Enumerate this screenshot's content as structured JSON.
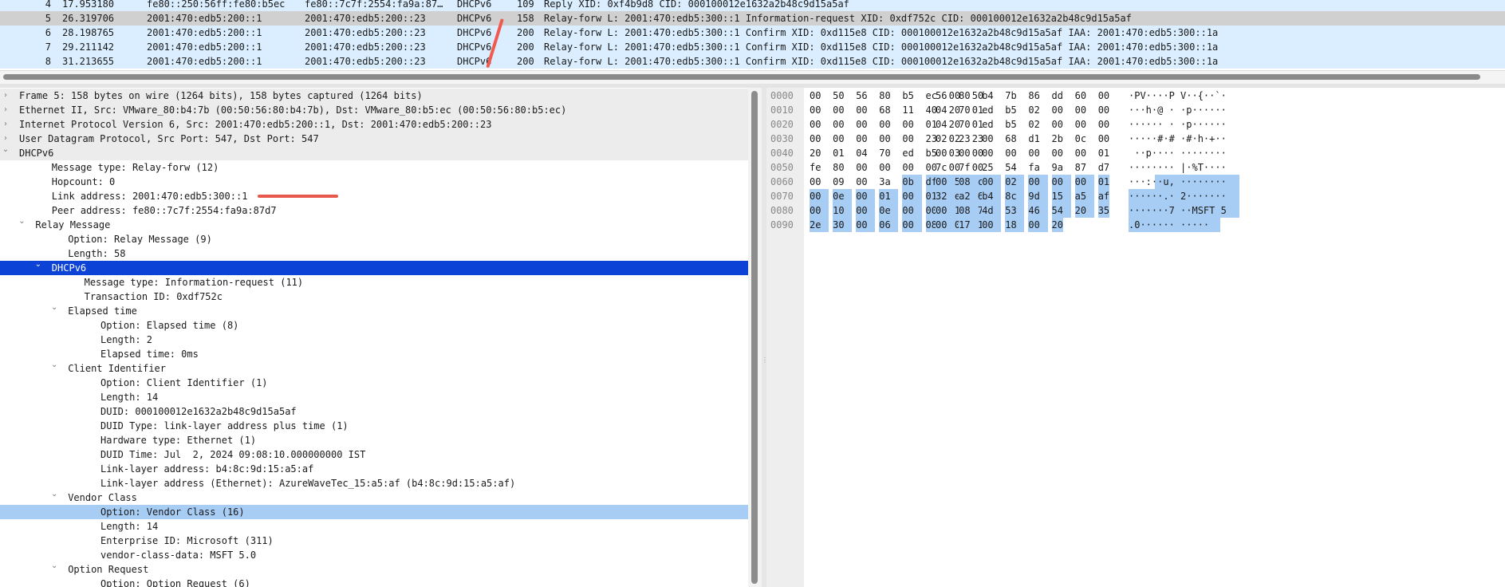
{
  "packet_list": {
    "rows": [
      {
        "no": "4",
        "time": "17.953180",
        "src": "fe80::250:56ff:fe80:b5ec",
        "dst": "fe80::7c7f:2554:fa9a:87…",
        "proto": "DHCPv6",
        "len": "109",
        "info": "Reply XID: 0xf4b9d8 CID: 000100012e1632a2b48c9d15a5af",
        "style": "udp"
      },
      {
        "no": "5",
        "time": "26.319706",
        "src": "2001:470:edb5:200::1",
        "dst": "2001:470:edb5:200::23",
        "proto": "DHCPv6",
        "len": "158",
        "info": "Relay-forw L: 2001:470:edb5:300::1 Information-request XID: 0xdf752c CID: 000100012e1632a2b48c9d15a5af",
        "style": "selected"
      },
      {
        "no": "6",
        "time": "28.198765",
        "src": "2001:470:edb5:200::1",
        "dst": "2001:470:edb5:200::23",
        "proto": "DHCPv6",
        "len": "200",
        "info": "Relay-forw L: 2001:470:edb5:300::1 Confirm XID: 0xd115e8 CID: 000100012e1632a2b48c9d15a5af IAA: 2001:470:edb5:300::1a",
        "style": "udp"
      },
      {
        "no": "7",
        "time": "29.211142",
        "src": "2001:470:edb5:200::1",
        "dst": "2001:470:edb5:200::23",
        "proto": "DHCPv6",
        "len": "200",
        "info": "Relay-forw L: 2001:470:edb5:300::1 Confirm XID: 0xd115e8 CID: 000100012e1632a2b48c9d15a5af IAA: 2001:470:edb5:300::1a",
        "style": "udp"
      },
      {
        "no": "8",
        "time": "31.213655",
        "src": "2001:470:edb5:200::1",
        "dst": "2001:470:edb5:200::23",
        "proto": "DHCPv6",
        "len": "200",
        "info": "Relay-forw L: 2001:470:edb5:300::1 Confirm XID: 0xd115e8 CID: 000100012e1632a2b48c9d15a5af IAA: 2001:470:edb5:300::1a",
        "style": "udp"
      }
    ]
  },
  "details": {
    "rows": [
      {
        "depth": 0,
        "expander": "collapsed",
        "text": "Frame 5: 158 bytes on wire (1264 bits), 158 bytes captured (1264 bits)",
        "style": "hdr"
      },
      {
        "depth": 0,
        "expander": "collapsed",
        "text": "Ethernet II, Src: VMware_80:b4:7b (00:50:56:80:b4:7b), Dst: VMware_80:b5:ec (00:50:56:80:b5:ec)",
        "style": "hdr"
      },
      {
        "depth": 0,
        "expander": "collapsed",
        "text": "Internet Protocol Version 6, Src: 2001:470:edb5:200::1, Dst: 2001:470:edb5:200::23",
        "style": "hdr"
      },
      {
        "depth": 0,
        "expander": "collapsed",
        "text": "User Datagram Protocol, Src Port: 547, Dst Port: 547",
        "style": "hdr"
      },
      {
        "depth": 0,
        "expander": "expanded",
        "text": "DHCPv6",
        "style": "hdr"
      },
      {
        "depth": 2,
        "expander": "none",
        "text": "Message type: Relay-forw (12)",
        "style": ""
      },
      {
        "depth": 2,
        "expander": "none",
        "text": "Hopcount: 0",
        "style": ""
      },
      {
        "depth": 2,
        "expander": "none",
        "text": "Link address: 2001:470:edb5:300::1",
        "style": ""
      },
      {
        "depth": 2,
        "expander": "none",
        "text": "Peer address: fe80::7c7f:2554:fa9a:87d7",
        "style": ""
      },
      {
        "depth": 1,
        "expander": "expanded",
        "text": "Relay Message",
        "style": ""
      },
      {
        "depth": 3,
        "expander": "none",
        "text": "Option: Relay Message (9)",
        "style": ""
      },
      {
        "depth": 3,
        "expander": "none",
        "text": "Length: 58",
        "style": ""
      },
      {
        "depth": 2,
        "expander": "expanded",
        "text": "DHCPv6",
        "style": "selected"
      },
      {
        "depth": 4,
        "expander": "none",
        "text": "Message type: Information-request (11)",
        "style": ""
      },
      {
        "depth": 4,
        "expander": "none",
        "text": "Transaction ID: 0xdf752c",
        "style": ""
      },
      {
        "depth": 3,
        "expander": "expanded",
        "text": "Elapsed time",
        "style": ""
      },
      {
        "depth": 5,
        "expander": "none",
        "text": "Option: Elapsed time (8)",
        "style": ""
      },
      {
        "depth": 5,
        "expander": "none",
        "text": "Length: 2",
        "style": ""
      },
      {
        "depth": 5,
        "expander": "none",
        "text": "Elapsed time: 0ms",
        "style": ""
      },
      {
        "depth": 3,
        "expander": "expanded",
        "text": "Client Identifier",
        "style": ""
      },
      {
        "depth": 5,
        "expander": "none",
        "text": "Option: Client Identifier (1)",
        "style": ""
      },
      {
        "depth": 5,
        "expander": "none",
        "text": "Length: 14",
        "style": ""
      },
      {
        "depth": 5,
        "expander": "none",
        "text": "DUID: 000100012e1632a2b48c9d15a5af",
        "style": ""
      },
      {
        "depth": 5,
        "expander": "none",
        "text": "DUID Type: link-layer address plus time (1)",
        "style": ""
      },
      {
        "depth": 5,
        "expander": "none",
        "text": "Hardware type: Ethernet (1)",
        "style": ""
      },
      {
        "depth": 5,
        "expander": "none",
        "text": "DUID Time: Jul  2, 2024 09:08:10.000000000 IST",
        "style": ""
      },
      {
        "depth": 5,
        "expander": "none",
        "text": "Link-layer address: b4:8c:9d:15:a5:af",
        "style": ""
      },
      {
        "depth": 5,
        "expander": "none",
        "text": "Link-layer address (Ethernet): AzureWaveTec_15:a5:af (b4:8c:9d:15:a5:af)",
        "style": ""
      },
      {
        "depth": 3,
        "expander": "expanded",
        "text": "Vendor Class",
        "style": ""
      },
      {
        "depth": 5,
        "expander": "none",
        "text": "Option: Vendor Class (16)",
        "style": "hl"
      },
      {
        "depth": 5,
        "expander": "none",
        "text": "Length: 14",
        "style": ""
      },
      {
        "depth": 5,
        "expander": "none",
        "text": "Enterprise ID: Microsoft (311)",
        "style": ""
      },
      {
        "depth": 5,
        "expander": "none",
        "text": "vendor-class-data: MSFT 5.0",
        "style": ""
      },
      {
        "depth": 3,
        "expander": "expanded",
        "text": "Option Request",
        "style": ""
      },
      {
        "depth": 5,
        "expander": "none",
        "text": "Option: Option Request (6)",
        "style": ""
      }
    ]
  },
  "bytes": {
    "rows": [
      {
        "offset": "0000",
        "hex": [
          "00",
          "50",
          "56",
          "80",
          "b5",
          "ec",
          "00",
          "50",
          "56",
          "80",
          "b4",
          "7b",
          "86",
          "dd",
          "60",
          "00"
        ],
        "ascii": "·PV····P V··{··`·",
        "sel_from": -1
      },
      {
        "offset": "0010",
        "hex": [
          "00",
          "00",
          "00",
          "68",
          "11",
          "40",
          "20",
          "01",
          "04",
          "70",
          "ed",
          "b5",
          "02",
          "00",
          "00",
          "00"
        ],
        "ascii": "···h·@ · ·p······",
        "sel_from": -1
      },
      {
        "offset": "0020",
        "hex": [
          "00",
          "00",
          "00",
          "00",
          "00",
          "01",
          "20",
          "01",
          "04",
          "70",
          "ed",
          "b5",
          "02",
          "00",
          "00",
          "00"
        ],
        "ascii": "······ · ·p······",
        "sel_from": -1
      },
      {
        "offset": "0030",
        "hex": [
          "00",
          "00",
          "00",
          "00",
          "00",
          "23",
          "02",
          "23",
          "02",
          "23",
          "00",
          "68",
          "d1",
          "2b",
          "0c",
          "00"
        ],
        "ascii": "·····#·# ·#·h·+··",
        "sel_from": -1
      },
      {
        "offset": "0040",
        "hex": [
          "20",
          "01",
          "04",
          "70",
          "ed",
          "b5",
          "03",
          "00",
          "00",
          "00",
          "00",
          "00",
          "00",
          "00",
          "00",
          "01"
        ],
        "ascii": " ··p···· ········",
        "sel_from": -1
      },
      {
        "offset": "0050",
        "hex": [
          "fe",
          "80",
          "00",
          "00",
          "00",
          "00",
          "00",
          "00",
          "7c",
          "7f",
          "25",
          "54",
          "fa",
          "9a",
          "87",
          "d7"
        ],
        "ascii": "········ |·%T····",
        "sel_from": -1
      },
      {
        "offset": "0060",
        "hex": [
          "00",
          "09",
          "00",
          "3a",
          "0b",
          "df",
          "75",
          "2c",
          "00",
          "08",
          "00",
          "02",
          "00",
          "00",
          "00",
          "01"
        ],
        "ascii": "···:··u, ········",
        "sel_from": 4
      },
      {
        "offset": "0070",
        "hex": [
          "00",
          "0e",
          "00",
          "01",
          "00",
          "01",
          "2e",
          "16",
          "32",
          "a2",
          "b4",
          "8c",
          "9d",
          "15",
          "a5",
          "af"
        ],
        "ascii": "······.· 2·······",
        "sel_from": 0
      },
      {
        "offset": "0080",
        "hex": [
          "00",
          "10",
          "00",
          "0e",
          "00",
          "00",
          "01",
          "37",
          "00",
          "08",
          "4d",
          "53",
          "46",
          "54",
          "20",
          "35"
        ],
        "ascii": "·······7 ··MSFT 5",
        "sel_from": 0
      },
      {
        "offset": "0090",
        "hex": [
          "2e",
          "30",
          "00",
          "06",
          "00",
          "08",
          "00",
          "11",
          "00",
          "17",
          "00",
          "18",
          "00",
          "20"
        ],
        "ascii": ".0······ ·····",
        "sel_from": 0
      }
    ]
  },
  "colors": {
    "udp_row": "#daeeff",
    "selected_packet": "#d0d0d0",
    "selected_tree": "#0c43d6",
    "highlight": "#a8cdf5",
    "annotation": "#f05a4f"
  }
}
